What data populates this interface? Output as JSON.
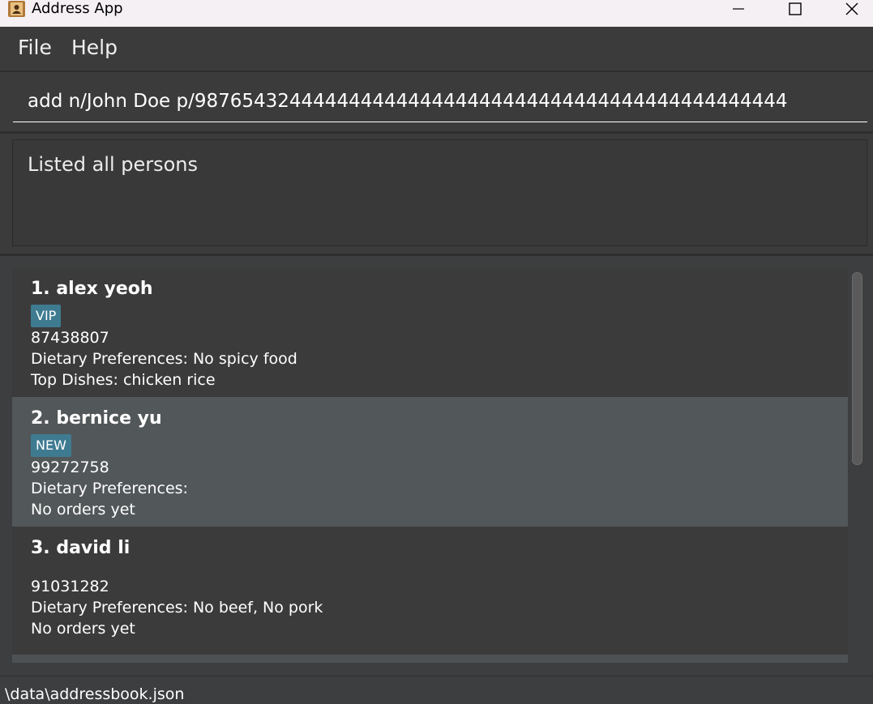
{
  "window": {
    "title": "Address App"
  },
  "menu": {
    "file": "File",
    "help": "Help"
  },
  "command": {
    "value": "add n/John Doe p/98765432444444444444444444444444444444444444444444"
  },
  "result": {
    "message": "Listed all persons"
  },
  "persons": [
    {
      "name": "1. alex yeoh",
      "tag": "VIP",
      "phone": "87438807",
      "dietary": "Dietary Preferences: No spicy food",
      "dishes": "Top Dishes: chicken rice"
    },
    {
      "name": "2. bernice yu",
      "tag": "NEW",
      "phone": "99272758",
      "dietary": "Dietary Preferences:",
      "dishes": "No orders yet"
    },
    {
      "name": "3. david li",
      "phone": "91031282",
      "dietary": "Dietary Preferences: No beef, No pork",
      "dishes": "No orders yet"
    }
  ],
  "status": {
    "path": "\\data\\addressbook.json"
  },
  "colors": {
    "tag_background": "#3e7b91",
    "selected_card": "#525759",
    "card": "#3b3b3b"
  }
}
